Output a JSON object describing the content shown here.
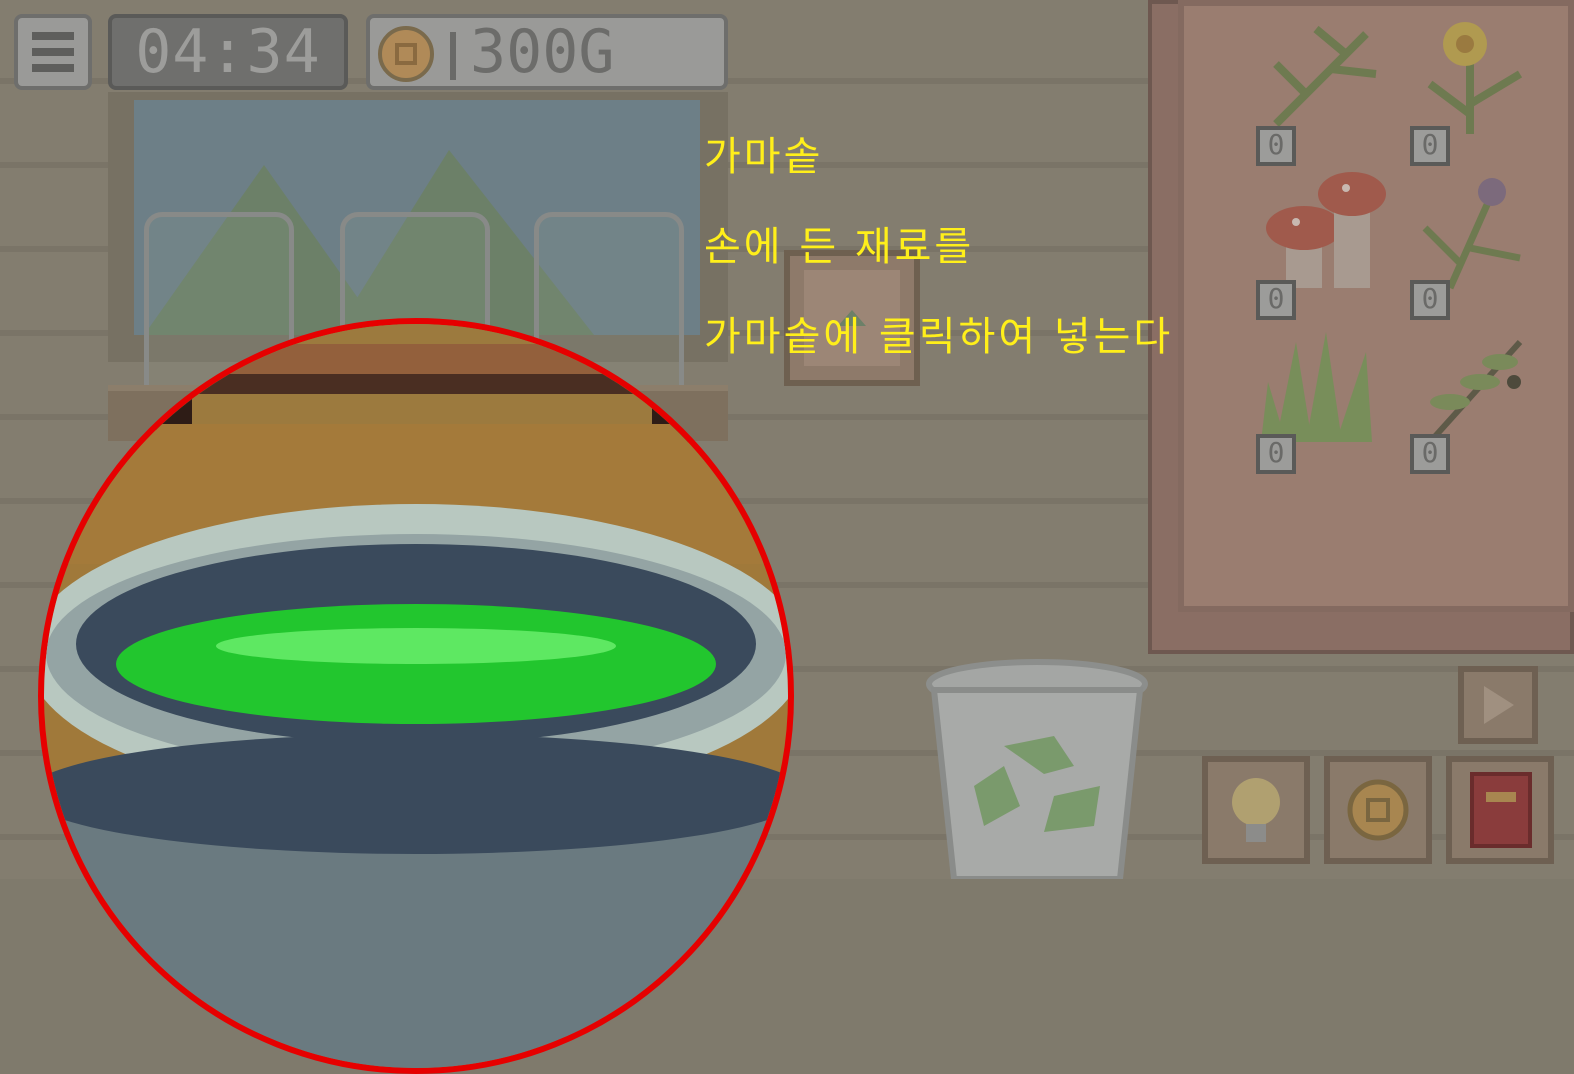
{
  "hud": {
    "menu_icon": "hamburger-menu-icon",
    "timer": "04:34",
    "gold_icon": "coin-icon",
    "gold": "300G"
  },
  "tutorial": {
    "line1": "가마솥",
    "line2": "손에 든 재료를",
    "line3": "가마솥에 클릭하여 넣는다",
    "color": "#ffef1a"
  },
  "inventory": {
    "items": [
      {
        "name": "herb",
        "count": "0"
      },
      {
        "name": "yellow-flower",
        "count": "0"
      },
      {
        "name": "mushroom",
        "count": "0"
      },
      {
        "name": "thistle",
        "count": "0"
      },
      {
        "name": "aloe",
        "count": "0"
      },
      {
        "name": "olive-branch",
        "count": "0"
      }
    ]
  },
  "buttons": {
    "hint": "lightbulb-icon",
    "shop": "coin-icon",
    "recipe_book": "book-icon",
    "next": "play-icon",
    "trash": "recycle-icon"
  },
  "colors": {
    "highlight_ring": "#e60000",
    "potion": "#1fc42e"
  }
}
